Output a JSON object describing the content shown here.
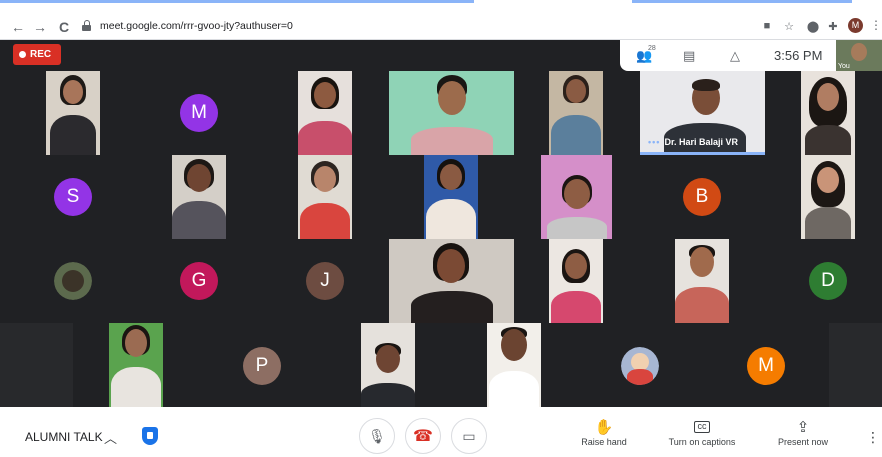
{
  "browser": {
    "url": "meet.google.com/rrr-gvoo-jty?authuser=0",
    "back_glyph": "←",
    "forward_glyph": "→",
    "reload_glyph": "C",
    "profile_initial": "M",
    "kebab_glyph": "⋮"
  },
  "recording": {
    "label": "REC"
  },
  "top_panel": {
    "participants_count": "28",
    "time": "3:56 PM",
    "self_label": "You"
  },
  "tiles": {
    "speaker_name": "Dr. Hari Balaji VR",
    "avatars": [
      {
        "letter": "M",
        "color": "#9334e6"
      },
      {
        "letter": "S",
        "color": "#9334e6"
      },
      {
        "letter": "B",
        "color": "#d14a14"
      },
      {
        "letter": "G",
        "color": "#c2185b"
      },
      {
        "letter": "J",
        "color": "#6d4c41"
      },
      {
        "letter": "D",
        "color": "#2e7d32"
      },
      {
        "letter": "P",
        "color": "#8d6e63"
      },
      {
        "letter": "M",
        "color": "#f57c00"
      }
    ]
  },
  "bottom_bar": {
    "meeting_name": "ALUMNI TALK",
    "raise_hand": "Raise hand",
    "captions": "Turn on captions",
    "present": "Present now"
  },
  "colors": {
    "stage": "#202124",
    "rec": "#d93025",
    "accent": "#8ab4f8",
    "shield": "#1a73e8"
  }
}
